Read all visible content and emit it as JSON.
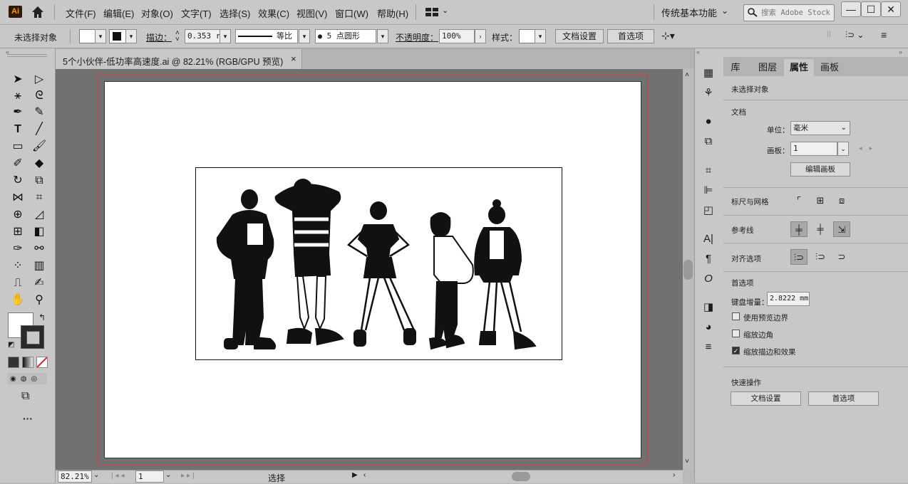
{
  "app": {
    "logo": "Ai"
  },
  "menu": [
    "文件(F)",
    "编辑(E)",
    "对象(O)",
    "文字(T)",
    "选择(S)",
    "效果(C)",
    "视图(V)",
    "窗口(W)",
    "帮助(H)"
  ],
  "workspace": "传统基本功能",
  "search": {
    "placeholder": "搜索 Adobe Stock"
  },
  "window_buttons": [
    "—",
    "☐",
    "✕"
  ],
  "control": {
    "no_selection": "未选择对象",
    "stroke_label": "描边：",
    "stroke_value": "0.353 r",
    "stroke_profile": "等比",
    "brush": "5 点圆形",
    "opacity_label": "不透明度：",
    "opacity_value": "100%",
    "style_label": "样式：",
    "doc_setup": "文档设置",
    "preferences": "首选项"
  },
  "document_tab": {
    "title": "5个小伙伴-低功率高速度.ai @ 82.21% (RGB/GPU 预览)",
    "close": "×"
  },
  "status": {
    "zoom": "82.21%",
    "artboard": "1",
    "tool": "选择"
  },
  "panel": {
    "tabs": [
      "库",
      "图层",
      "属性",
      "画板"
    ],
    "active_tab": "属性",
    "selection": "未选择对象",
    "doc_section": "文档",
    "unit_label": "单位：",
    "unit_value": "毫米",
    "artboard_label": "画板：",
    "artboard_value": "1",
    "edit_artboard": "编辑画板",
    "rulers_grids": "标尺与网格",
    "guides": "参考线",
    "align_options": "对齐选项",
    "prefs_section": "首选项",
    "keyboard_increment_label": "键盘增量：",
    "keyboard_increment_value": "2.8222 mm",
    "use_preview_bounds": "使用预览边界",
    "scale_corners": "缩放边角",
    "scale_strokes": "缩放描边和效果",
    "quick_actions": "快速操作",
    "qa_doc_setup": "文档设置",
    "qa_preferences": "首选项"
  },
  "checkbox_states": {
    "use_preview_bounds": false,
    "scale_corners": false,
    "scale_strokes": true
  },
  "colors": {
    "chrome": "#c8c8c8",
    "canvas": "#717171",
    "artboard_border": "#e03a3a"
  }
}
